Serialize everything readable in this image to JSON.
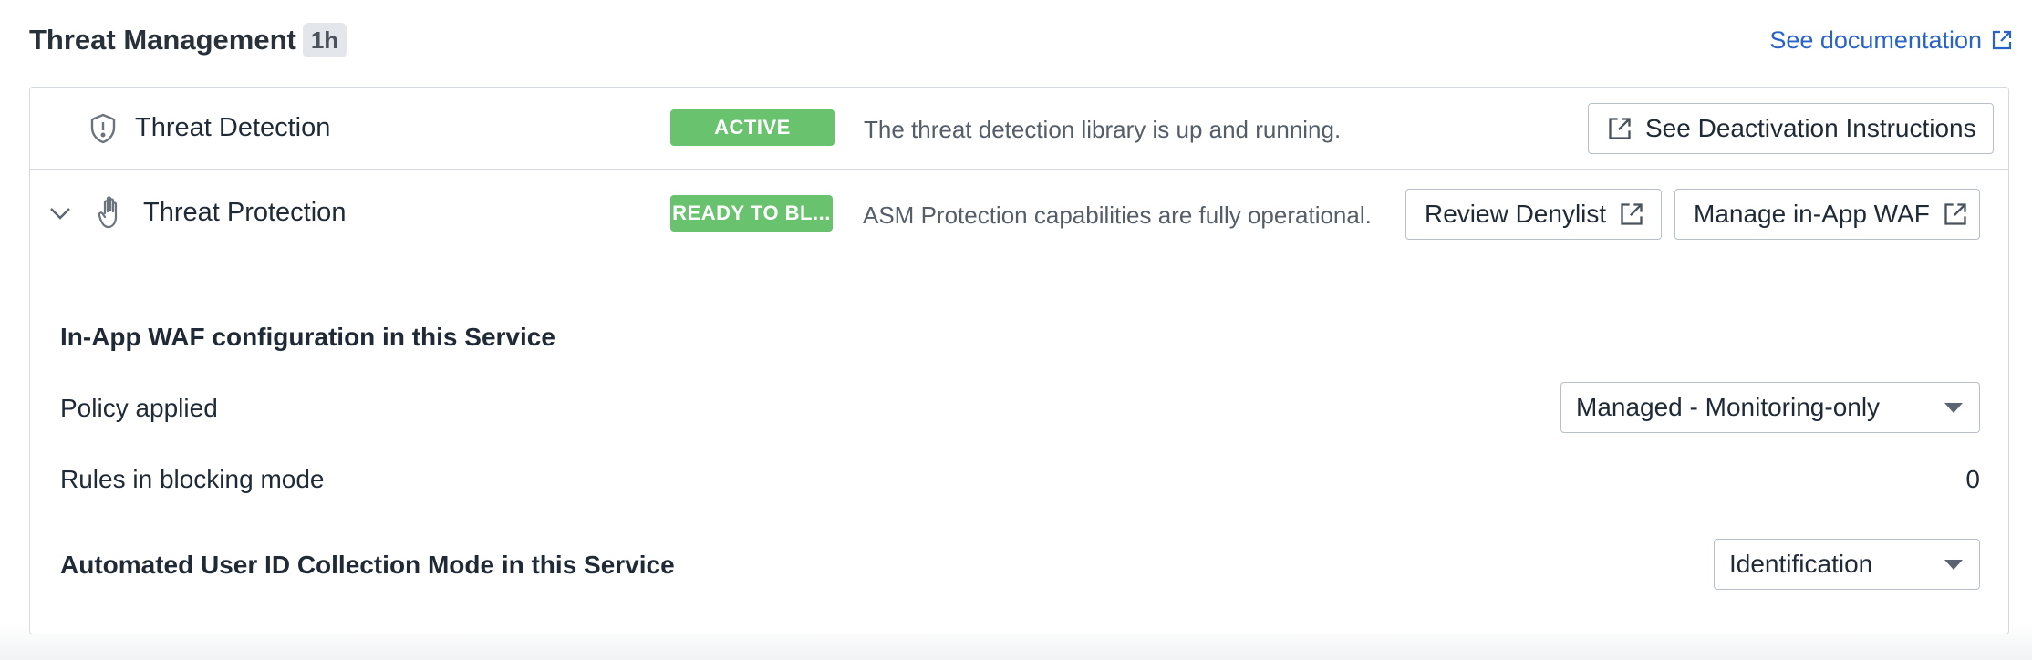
{
  "header": {
    "title": "Threat Management",
    "time_badge": "1h",
    "doc_link": "See documentation"
  },
  "features": [
    {
      "name": "Threat Detection",
      "status": "ACTIVE",
      "description": "The threat detection library is up and running.",
      "action_label": "See Deactivation Instructions",
      "icon": "shield-alert-icon"
    },
    {
      "name": "Threat Protection",
      "status": "READY TO BL...",
      "description": "ASM Protection capabilities are fully operational.",
      "actions": [
        "Review Denylist",
        "Manage in-App WAF"
      ],
      "icon": "hand-icon",
      "expanded": true
    }
  ],
  "waf_config": {
    "section_title": "In-App WAF configuration in this Service",
    "policy_label": "Policy applied",
    "policy_value": "Managed - Monitoring-only",
    "rules_label": "Rules in blocking mode",
    "rules_value": "0",
    "user_id_label": "Automated User ID Collection Mode in this Service",
    "user_id_value": "Identification"
  },
  "colors": {
    "status_green": "#69c26d",
    "link_blue": "#2a63c8",
    "border": "#d6dadf"
  }
}
